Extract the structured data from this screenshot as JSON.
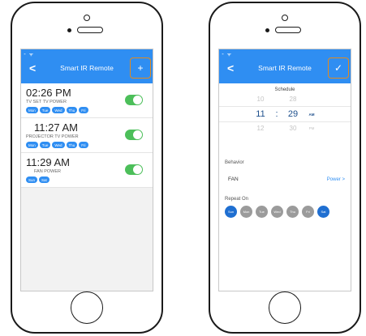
{
  "app": {
    "title": "Smart IR Remote"
  },
  "list_screen": {
    "status": "⁃ ᯤ",
    "action_icon": "+",
    "items": [
      {
        "time": "02:26 PM",
        "device": "TV SET TV Power",
        "days": [
          "Mon",
          "Tue",
          "Wed",
          "Thu",
          "Fri"
        ],
        "enabled": true
      },
      {
        "time": "11:27 AM",
        "device": "PROJECTOR TV Power",
        "days": [
          "Mon",
          "Tue",
          "Wed",
          "Thu",
          "Fri"
        ],
        "enabled": true
      },
      {
        "time": "11:29 AM",
        "device": "FAN Power",
        "days": [
          "Sun",
          "Sat"
        ],
        "enabled": true
      }
    ]
  },
  "edit_screen": {
    "status": "⁃ ᯤ",
    "action_icon": "✓",
    "schedule_label": "Schedule",
    "picker": {
      "above": {
        "hour": "10",
        "minute": "28"
      },
      "selected": {
        "hour": "11",
        "separator": ":",
        "minute": "29",
        "ampm": "AM"
      },
      "below": {
        "hour": "12",
        "minute": "30",
        "ampm": "PM"
      }
    },
    "behavior_label": "Behavior",
    "device": "FAN",
    "action": "Power",
    "action_chevron": ">",
    "repeat_label": "Repeat On",
    "days": [
      {
        "label": "Sun",
        "on": true
      },
      {
        "label": "Mon",
        "on": false
      },
      {
        "label": "Tue",
        "on": false
      },
      {
        "label": "Wed",
        "on": false
      },
      {
        "label": "Thu",
        "on": false
      },
      {
        "label": "Fri",
        "on": false
      },
      {
        "label": "Sat",
        "on": true
      }
    ]
  },
  "colors": {
    "nav": "#2f8ef2",
    "toggle_on": "#4cbf5a",
    "day_on": "#1f6fd1",
    "day_off": "#9b9b9b",
    "highlight": "#e38a1d"
  }
}
